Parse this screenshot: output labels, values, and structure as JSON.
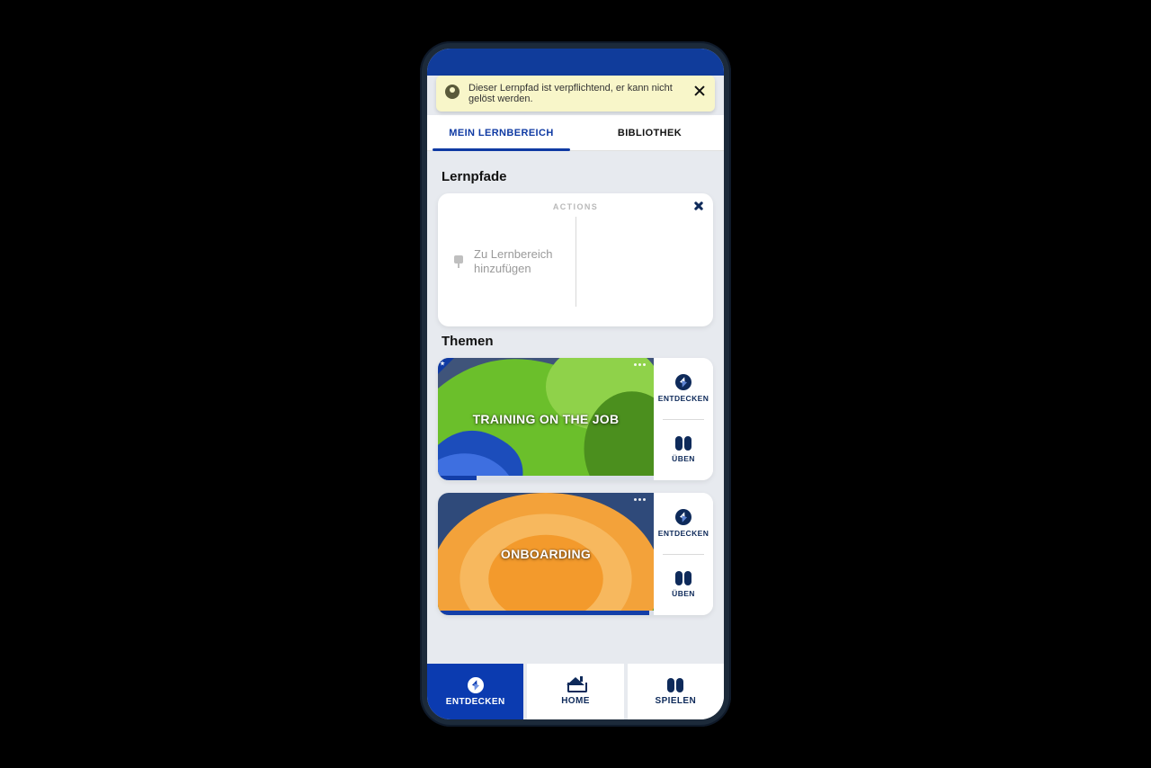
{
  "toast": {
    "text": "Dieser Lernpfad ist verpflichtend, er kann nicht gelöst werden."
  },
  "tabs": {
    "tab1": "MEIN LERNBEREICH",
    "tab2": "BIBLIOTHEK"
  },
  "sections": {
    "lernpfade": "Lernpfade",
    "themen": "Themen"
  },
  "actions": {
    "header": "ACTIONS",
    "add_label": "Zu Lernbereich hinzufügen"
  },
  "themes": [
    {
      "title": "TRAINING ON THE JOB",
      "progress_pct": 18
    },
    {
      "title": "ONBOARDING",
      "progress_pct": 98
    }
  ],
  "side_buttons": {
    "entdecken": "ENTDECKEN",
    "ueben": "ÜBEN"
  },
  "bottom_nav": {
    "entdecken": "ENTDECKEN",
    "home": "HOME",
    "spielen": "SPIELEN"
  },
  "colors": {
    "brand_blue": "#0f3aa3",
    "dark_navy": "#0e2a5a",
    "toast_bg": "#f8f6c9"
  }
}
